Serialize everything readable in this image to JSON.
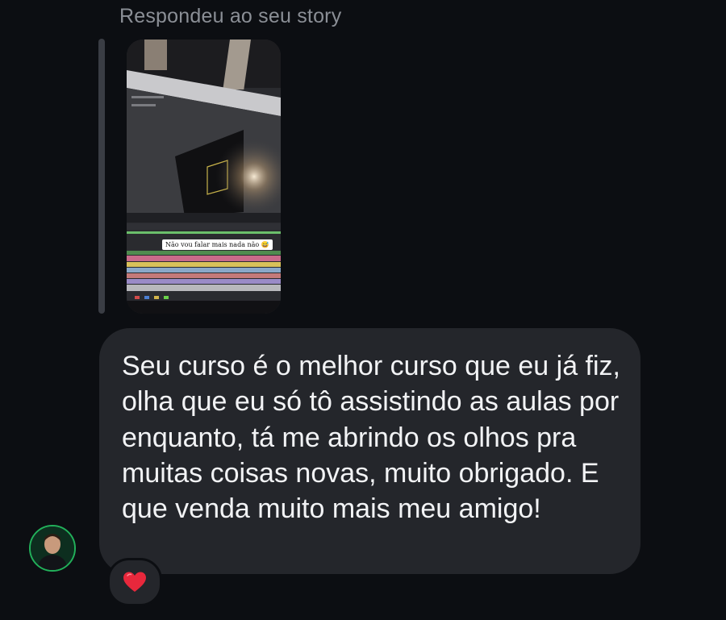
{
  "story_reply": {
    "label": "Respondeu ao seu story",
    "thumbnail_caption": "Não vou falar mais nada não 😅"
  },
  "message": {
    "text": "Seu curso é o melhor curso que eu já fiz, olha que eu só tô assistindo as aulas por enquanto, tá me abrindo os olhos pra muitas coisas novas, muito obrigado. E que venda muito mais meu amigo!"
  },
  "reaction": {
    "icon": "heart-icon",
    "emoji": "❤️"
  },
  "colors": {
    "background": "#0c0e12",
    "bubble": "#24262b",
    "secondary_text": "#8b8f96",
    "avatar_ring": "#22b05a"
  }
}
